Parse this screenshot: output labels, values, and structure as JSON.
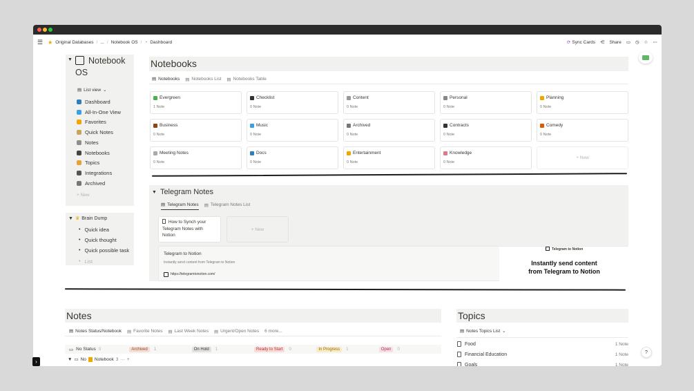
{
  "window": {
    "traffic_lights": [
      "#ff5f56",
      "#ffbd2e",
      "#27c93f"
    ]
  },
  "topbar": {
    "breadcrumb": [
      "Original Databases",
      "/",
      "...",
      "/",
      "Notebook OS",
      "/",
      "Dashboard"
    ],
    "sync_cards": "Sync Cards",
    "share": "Share"
  },
  "sidebar": {
    "title_line1": "Notebook",
    "title_line2": "OS",
    "view": "List view",
    "items": [
      {
        "label": "Dashboard",
        "icon": "dashboard-icon",
        "color": "#2f7fbf"
      },
      {
        "label": "All-In-One View",
        "icon": "diamond-icon",
        "color": "#3ba0e0"
      },
      {
        "label": "Favorites",
        "icon": "star-icon",
        "color": "#f0a500"
      },
      {
        "label": "Quick Notes",
        "icon": "notepad-icon",
        "color": "#c9a55b"
      },
      {
        "label": "Notes",
        "icon": "note-icon",
        "color": "#8e8e8e"
      },
      {
        "label": "Notebooks",
        "icon": "notebook-icon",
        "color": "#444444"
      },
      {
        "label": "Topics",
        "icon": "topics-icon",
        "color": "#e8a233"
      },
      {
        "label": "Integrations",
        "icon": "gear-icon",
        "color": "#555555"
      },
      {
        "label": "Archived",
        "icon": "archive-icon",
        "color": "#777777"
      }
    ],
    "new": "+ New"
  },
  "brain_dump": {
    "title": "Brain Dump",
    "items": [
      "Quick idea",
      "Quick thought",
      "Quick possible task",
      "List"
    ]
  },
  "notebooks": {
    "title": "Notebooks",
    "tabs": [
      "Notebooks",
      "Notebooks List",
      "Notebooks Table"
    ],
    "cards": [
      {
        "name": "Evergreen",
        "count": "1 Note",
        "icon": "sprout-icon",
        "color": "#4caf50"
      },
      {
        "name": "Checklist",
        "count": "0 Note",
        "icon": "check-icon",
        "color": "#333333"
      },
      {
        "name": "Content",
        "count": "0 Note",
        "icon": "content-icon",
        "color": "#999999"
      },
      {
        "name": "Personal",
        "count": "0 Note",
        "icon": "person-icon",
        "color": "#888888"
      },
      {
        "name": "Planning",
        "count": "0 Note",
        "icon": "planning-icon",
        "color": "#f0a500"
      },
      {
        "name": "Business",
        "count": "0 Note",
        "icon": "briefcase-icon",
        "color": "#8b4513"
      },
      {
        "name": "Music",
        "count": "0 Note",
        "icon": "music-icon",
        "color": "#3ba0e0"
      },
      {
        "name": "Archived",
        "count": "0 Note",
        "icon": "archive-icon",
        "color": "#777777"
      },
      {
        "name": "Contracts",
        "count": "0 Note",
        "icon": "pen-icon",
        "color": "#333333"
      },
      {
        "name": "Comedy",
        "count": "0 Note",
        "icon": "comedy-icon",
        "color": "#e05a00"
      },
      {
        "name": "Meeting Notes",
        "count": "0 Note",
        "icon": "pencil-icon",
        "color": "#aaaaaa"
      },
      {
        "name": "Docs",
        "count": "0 Note",
        "icon": "docs-icon",
        "color": "#2f7fbf"
      },
      {
        "name": "Entertainment",
        "count": "0 Note",
        "icon": "entertainment-icon",
        "color": "#f0a500"
      },
      {
        "name": "Knowledge",
        "count": "0 Note",
        "icon": "brain-icon",
        "color": "#e07a8a"
      }
    ],
    "new": "+ New"
  },
  "telegram": {
    "title": "Telegram Notes",
    "tabs": [
      "Telegram Notes",
      "Telegram Notes List"
    ],
    "card_title": "How to Synch your Telegram Notes with Notion",
    "new": "+ New",
    "bookmark_title": "Telegram to Notion",
    "bookmark_desc": "Instantly send content from Telegram to Notion",
    "bookmark_url": "https://telegramtonotion.com/",
    "preview_brand": "Telegram to Notion",
    "preview_line1": "Instantly send content",
    "preview_line2": "from Telegram to Notion"
  },
  "notes": {
    "title": "Notes",
    "tabs": [
      "Notes Status/Notebook",
      "Favorite Notes",
      "Last Week Notes",
      "Urgent/Open Notes"
    ],
    "more": "6 more...",
    "status_label": "No Status",
    "status_count": "0",
    "statuses": [
      {
        "label": "Archived",
        "count": "1",
        "bg": "#f4dfd6",
        "fg": "#8a4a2d"
      },
      {
        "label": "On Hold",
        "count": "1",
        "bg": "#e3e2e0",
        "fg": "#37352f"
      },
      {
        "label": "Ready to Start",
        "count": "0",
        "bg": "#fbdcdc",
        "fg": "#b5342a"
      },
      {
        "label": "In Progress",
        "count": "1",
        "bg": "#fbecc8",
        "fg": "#8a6a10"
      },
      {
        "label": "Open",
        "count": "0",
        "bg": "#f8dde6",
        "fg": "#a33a5c"
      }
    ],
    "group_prefix": "No",
    "group_name": "Notebook",
    "group_count": "3",
    "group_more": "···",
    "group_add": "+"
  },
  "topics": {
    "title": "Topics",
    "view": "Notes Topics List",
    "rows": [
      {
        "name": "Food",
        "count": "1 Note"
      },
      {
        "name": "Financial Education",
        "count": "1 Note"
      },
      {
        "name": "Goals",
        "count": "1 Note"
      }
    ]
  },
  "help": "?"
}
